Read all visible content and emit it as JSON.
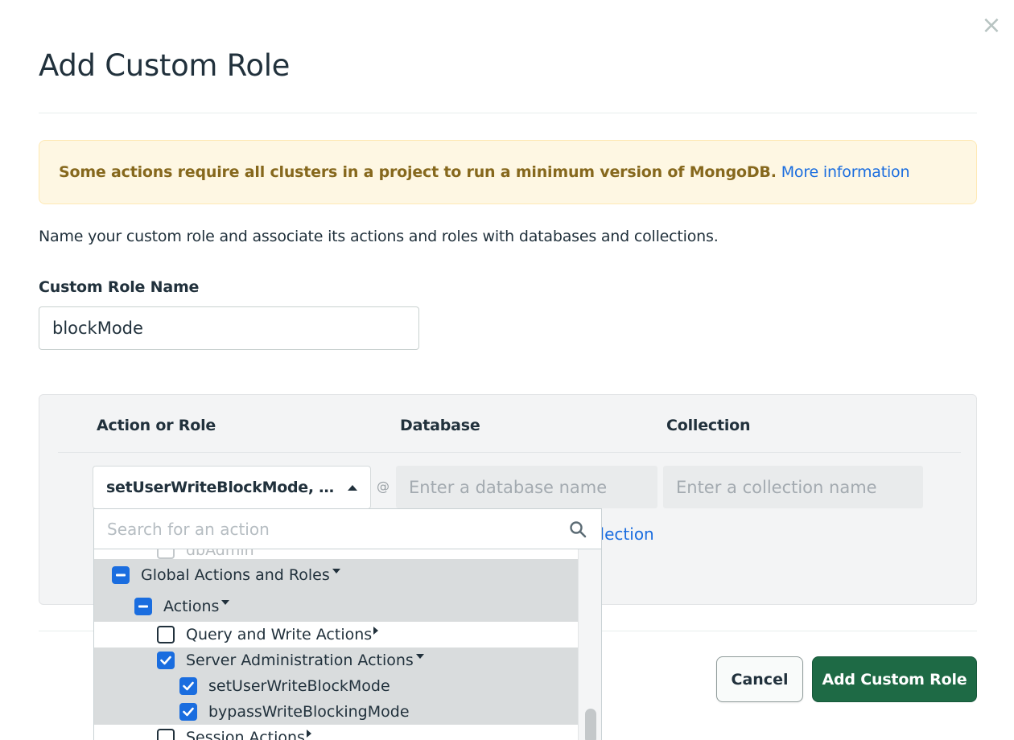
{
  "dialog": {
    "title": "Add Custom Role",
    "close_glyph": "×"
  },
  "banner": {
    "text": "Some actions require all clusters in a project to run a minimum version of MongoDB.",
    "link": "More information"
  },
  "description": "Name your custom role and associate its actions and roles with databases and collections.",
  "role_name": {
    "label": "Custom Role Name",
    "value": "blockMode"
  },
  "table": {
    "headers": [
      "Action or Role",
      "Database",
      "Collection"
    ],
    "action_value": "setUserWriteBlockMode, bypassWriteBlockingMode",
    "at_sign": "@",
    "database_placeholder": "Enter a database name",
    "collection_placeholder": "Enter a collection name",
    "partial_link": "llection"
  },
  "dropdown": {
    "search_placeholder": "Search for an action",
    "items": [
      {
        "label": "dbAdmin",
        "state": "faded",
        "expander": "none",
        "selected": false
      },
      {
        "label": "Global Actions and Roles",
        "state": "partial",
        "expander": "down",
        "selected": true
      },
      {
        "label": "Actions",
        "state": "partial",
        "expander": "down",
        "selected": true
      },
      {
        "label": "Query and Write Actions",
        "state": "empty",
        "expander": "right",
        "selected": false
      },
      {
        "label": "Server Administration Actions",
        "state": "checked",
        "expander": "down",
        "selected": true
      },
      {
        "label": "setUserWriteBlockMode",
        "state": "checked",
        "expander": "none",
        "selected": true
      },
      {
        "label": "bypassWriteBlockingMode",
        "state": "checked",
        "expander": "none",
        "selected": true
      },
      {
        "label": "Session Actions",
        "state": "empty",
        "expander": "right",
        "selected": false
      }
    ]
  },
  "buttons": {
    "cancel": "Cancel",
    "submit": "Add Custom Role"
  },
  "colors": {
    "primary_green": "#1e6a45",
    "link_blue": "#1a6ddf",
    "warning_bg": "#fef7e3",
    "warning_text": "#86681d"
  }
}
